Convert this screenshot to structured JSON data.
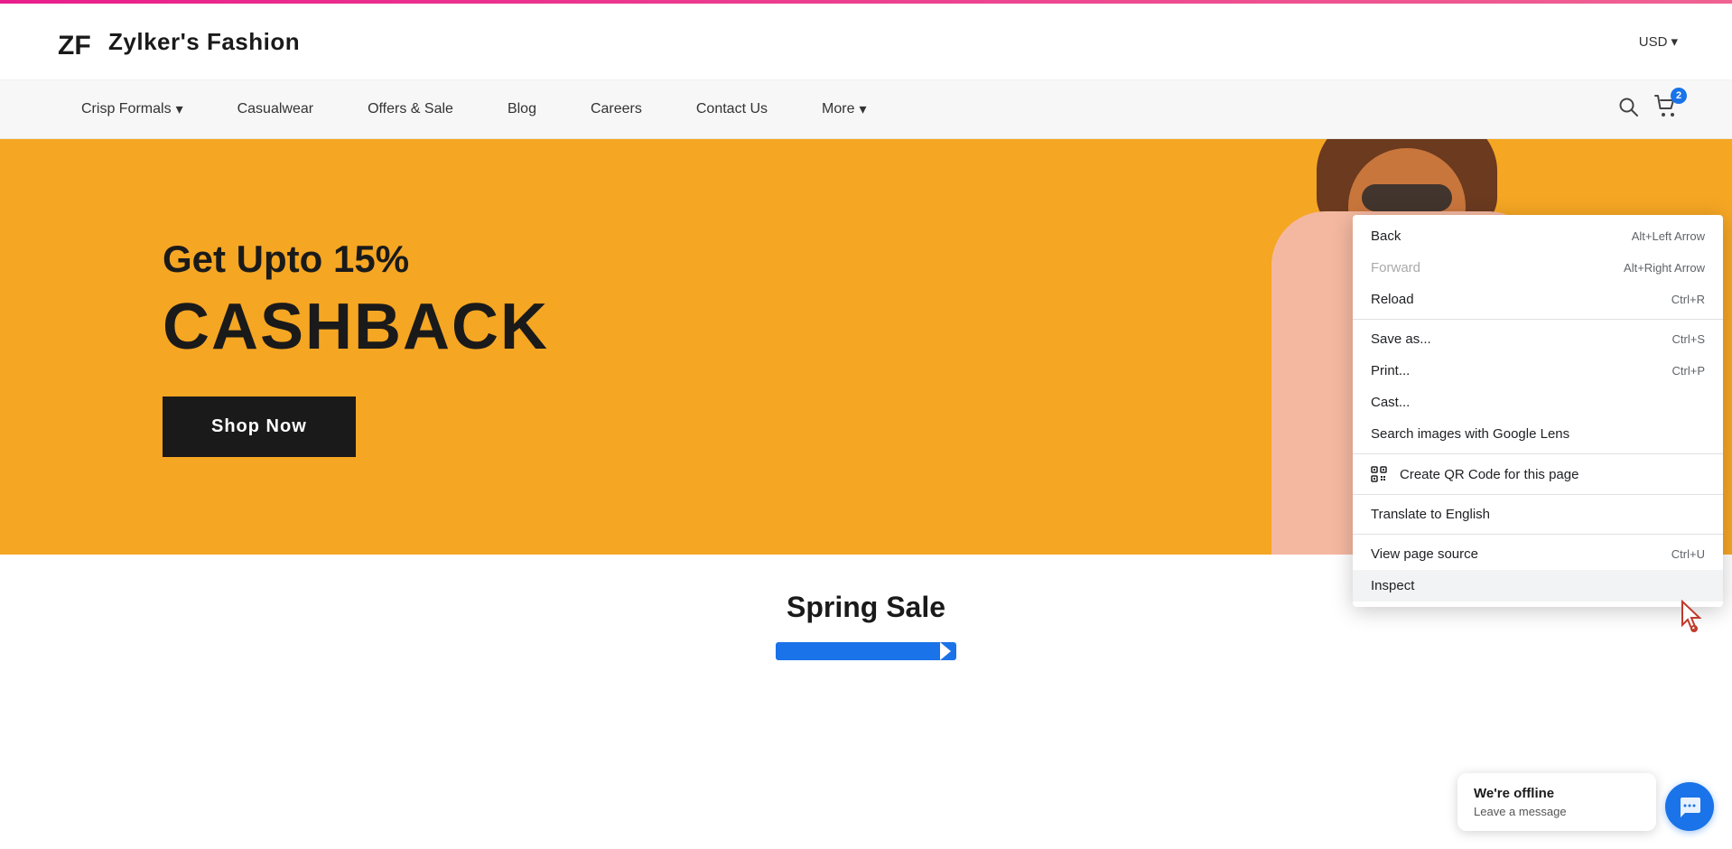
{
  "brand": {
    "name": "Zylker's Fashion",
    "logo_alt": "ZF"
  },
  "header": {
    "currency": "USD",
    "currency_arrow": "▾"
  },
  "nav": {
    "items": [
      {
        "label": "Crisp Formals",
        "has_dropdown": true
      },
      {
        "label": "Casualwear",
        "has_dropdown": false
      },
      {
        "label": "Offers & Sale",
        "has_dropdown": false
      },
      {
        "label": "Blog",
        "has_dropdown": false
      },
      {
        "label": "Careers",
        "has_dropdown": false
      },
      {
        "label": "Contact Us",
        "has_dropdown": false
      },
      {
        "label": "More",
        "has_dropdown": true
      }
    ],
    "cart_count": "2"
  },
  "hero": {
    "line1": "Get Upto 15%",
    "line2": "CASHBACK",
    "cta_label": "Shop Now",
    "bg_color": "#f5a623"
  },
  "below_hero": {
    "title": "Spring Sale"
  },
  "context_menu": {
    "items": [
      {
        "label": "Back",
        "shortcut": "Alt+Left Arrow",
        "disabled": false,
        "has_icon": false
      },
      {
        "label": "Forward",
        "shortcut": "Alt+Right Arrow",
        "disabled": true,
        "has_icon": false
      },
      {
        "label": "Reload",
        "shortcut": "Ctrl+R",
        "disabled": false,
        "has_icon": false
      },
      {
        "divider": true
      },
      {
        "label": "Save as...",
        "shortcut": "Ctrl+S",
        "disabled": false,
        "has_icon": false
      },
      {
        "label": "Print...",
        "shortcut": "Ctrl+P",
        "disabled": false,
        "has_icon": false
      },
      {
        "label": "Cast...",
        "shortcut": "",
        "disabled": false,
        "has_icon": false
      },
      {
        "label": "Search images with Google Lens",
        "shortcut": "",
        "disabled": false,
        "has_icon": false
      },
      {
        "divider": true
      },
      {
        "label": "Create QR Code for this page",
        "shortcut": "",
        "disabled": false,
        "has_icon": true
      },
      {
        "divider": true
      },
      {
        "label": "Translate to English",
        "shortcut": "",
        "disabled": false,
        "has_icon": false
      },
      {
        "divider": true
      },
      {
        "label": "View page source",
        "shortcut": "Ctrl+U",
        "disabled": false,
        "has_icon": false
      },
      {
        "label": "Inspect",
        "shortcut": "",
        "disabled": false,
        "has_icon": false,
        "highlighted": true
      }
    ]
  },
  "chat": {
    "title": "We're offline",
    "subtitle": "Leave a message",
    "button_icon": "💬"
  }
}
